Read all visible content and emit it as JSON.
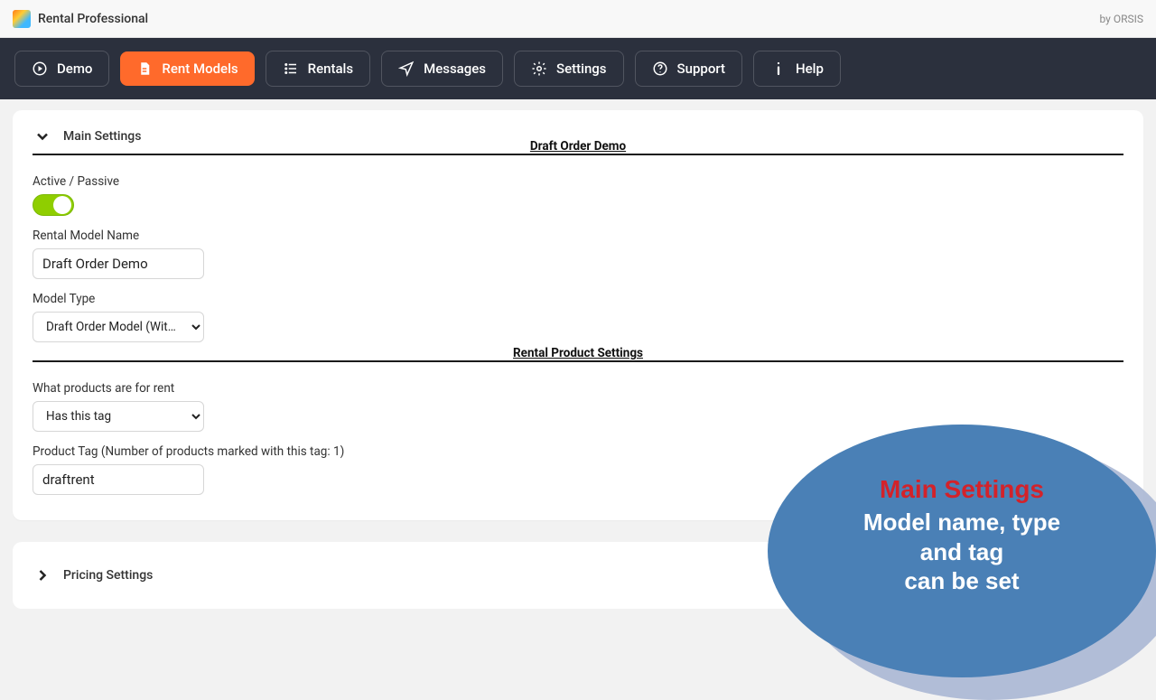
{
  "header": {
    "app_title": "Rental Professional",
    "by_text": "by ORSIS"
  },
  "nav": {
    "items": [
      {
        "label": "Demo",
        "icon": "play-circle",
        "active": false
      },
      {
        "label": "Rent Models",
        "icon": "file-rent",
        "active": true
      },
      {
        "label": "Rentals",
        "icon": "list",
        "active": false
      },
      {
        "label": "Messages",
        "icon": "send",
        "active": false
      },
      {
        "label": "Settings",
        "icon": "sliders",
        "active": false
      },
      {
        "label": "Support",
        "icon": "help-circle",
        "active": false
      },
      {
        "label": "Help",
        "icon": "info",
        "active": false
      }
    ]
  },
  "main_settings": {
    "section_title": "Main Settings",
    "fieldset1_title": "Draft Order Demo",
    "active_label": "Active / Passive",
    "active_state": true,
    "name_label": "Rental Model Name",
    "name_value": "Draft Order Demo",
    "type_label": "Model Type",
    "type_value": "Draft Order Model (With Deposit)",
    "fieldset2_title": "Rental Product Settings",
    "what_label": "What products are for rent",
    "what_value": "Has this tag",
    "tag_label": "Product Tag (Number of products marked with this tag: 1)",
    "tag_value": "draftrent"
  },
  "pricing": {
    "section_title": "Pricing Settings"
  },
  "callout": {
    "heading": "Main Settings",
    "line1": "Model name, type",
    "line2": "and tag",
    "line3": "can be set"
  }
}
